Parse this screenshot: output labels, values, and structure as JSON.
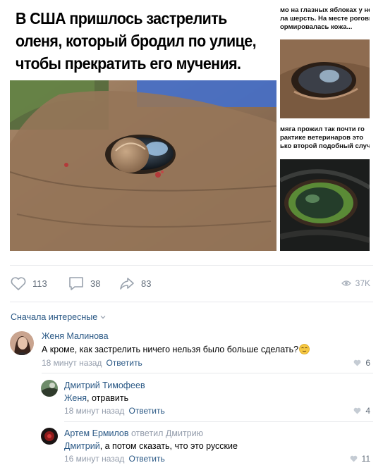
{
  "post": {
    "headline": "В США пришлось застрелить оленя, который бродил по улице, чтобы прекратить его мучения.",
    "side_text_1": [
      "мо на глазных яблоках у не",
      "ла шерсть. На месте рогови",
      "ормировалась кожа..."
    ],
    "side_text_2": [
      "мяга прожил так почти го",
      "рактике ветеринаров это",
      "ько второй подобный случ"
    ]
  },
  "actions": {
    "likes": "113",
    "comments": "38",
    "shares": "83",
    "views": "37K"
  },
  "comments_section": {
    "sort_label": "Сначала интересные",
    "items": [
      {
        "author": "Женя Малинова",
        "text": "А кроме, как застрелить ничего нельзя было больше сделать?",
        "time": "18 минут назад",
        "reply_label": "Ответить",
        "likes": "6"
      },
      {
        "author": "Дмитрий Тимофеев",
        "mention": "Женя",
        "text": ", отравить",
        "time": "18 минут назад",
        "reply_label": "Ответить",
        "likes": "4"
      },
      {
        "author": "Артем Ермилов",
        "replied_to": "ответил Дмитрию",
        "mention": "Дмитрий",
        "text": ", а потом сказать, что это русские",
        "time": "16 минут назад",
        "reply_label": "Ответить",
        "likes": "11"
      }
    ]
  },
  "colors": {
    "link": "#2a5885",
    "meta": "#939cab",
    "divider": "#e7e8ec",
    "action": "#626d7a"
  },
  "icons": [
    "heart-icon",
    "comment-icon",
    "share-icon",
    "eye-icon",
    "chevron-down-icon",
    "emoji-icon"
  ]
}
